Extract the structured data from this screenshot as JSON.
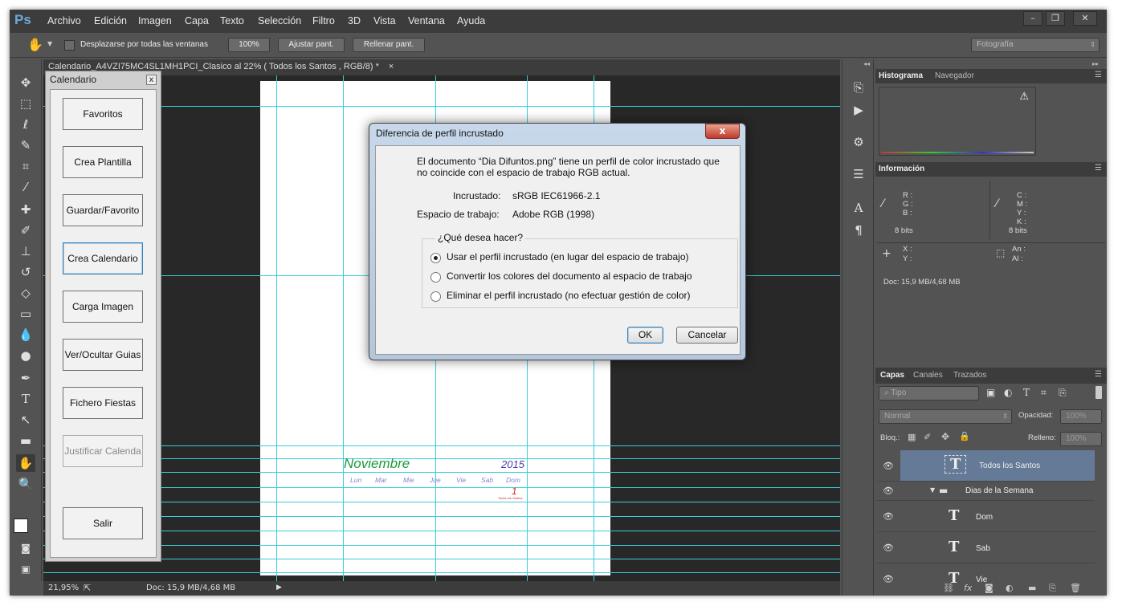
{
  "menu": {
    "logo": "Ps",
    "items": [
      "Archivo",
      "Edición",
      "Imagen",
      "Capa",
      "Texto",
      "Selección",
      "Filtro",
      "3D",
      "Vista",
      "Ventana",
      "Ayuda"
    ]
  },
  "options": {
    "scroll_all_label": "Desplazarse por todas las ventanas",
    "zoom100": "100%",
    "fit_screen": "Ajustar pant.",
    "fill_screen": "Rellenar pant.",
    "workspace": "Fotografía"
  },
  "document": {
    "tab_title": "Calendario_A4VZI75MC4SL1MH1PCI_Clasico al 22% ( Todos los Santos , RGB/8) *",
    "tab_close": "×",
    "month": "Noviembre",
    "year": "2015",
    "weekdays": [
      "Lun",
      "Mar",
      "Mie",
      "Jue",
      "Vie",
      "Sab",
      "Dom"
    ],
    "day1": "1",
    "day1_note": "Todos los Santos"
  },
  "calendar_panel": {
    "title": "Calendario",
    "close": "x",
    "buttons": [
      "Favoritos",
      "Crea Plantilla",
      "Guardar/Favorito",
      "Crea Calendario",
      "Carga Imagen",
      "Ver/Ocultar Guias",
      "Fichero Fiestas",
      "Justificar Calenda",
      "Salir"
    ]
  },
  "status": {
    "zoom": "21,95%",
    "doc": "Doc: 15,9 MB/4,68 MB"
  },
  "right": {
    "histogram_tab": "Histograma",
    "navigator_tab": "Navegador",
    "info_tab": "Información",
    "info_left": [
      "R :",
      "G :",
      "B :"
    ],
    "info_right": [
      "C :",
      "M :",
      "Y :",
      "K :"
    ],
    "bits_left": "8 bits",
    "bits_right": "8 bits",
    "xy": [
      "X :",
      "Y :"
    ],
    "anal": [
      "An :",
      "Al :"
    ],
    "doc": "Doc: 15,9 MB/4,68 MB",
    "layers_tab": "Capas",
    "channels_tab": "Canales",
    "paths_tab": "Trazados",
    "filter_kind": "Tipo",
    "blend_mode": "Normal",
    "opacity_label": "Opacidad:",
    "opacity_value": "100%",
    "lock_label": "Bloq.:",
    "fill_label": "Relleno:",
    "fill_value": "100%",
    "layers": [
      {
        "name": "Todos los Santos",
        "type": "text",
        "selected": true
      },
      {
        "name": "Dias de la Semana",
        "type": "group"
      },
      {
        "name": "Dom",
        "type": "text"
      },
      {
        "name": "Sab",
        "type": "text"
      },
      {
        "name": "Vie",
        "type": "text"
      }
    ]
  },
  "dialog": {
    "title": "Diferencia de perfil incrustado",
    "close": "x",
    "message_line1": "El documento “Dia Difuntos.png” tiene un perfil de color incrustado que",
    "message_line2": "no coincide con el espacio de trabajo RGB actual.",
    "embedded_label": "Incrustado:",
    "embedded_value": "sRGB IEC61966-2.1",
    "workspace_label": "Espacio de trabajo:",
    "workspace_value": "Adobe RGB (1998)",
    "question": "¿Qué desea hacer?",
    "options": [
      "Usar el perfil incrustado (en lugar del espacio de trabajo)",
      "Convertir los colores del documento al espacio de trabajo",
      "Eliminar el perfil incrustado (no efectuar gestión de color)"
    ],
    "selected_option": 0,
    "ok": "OK",
    "cancel": "Cancelar"
  }
}
